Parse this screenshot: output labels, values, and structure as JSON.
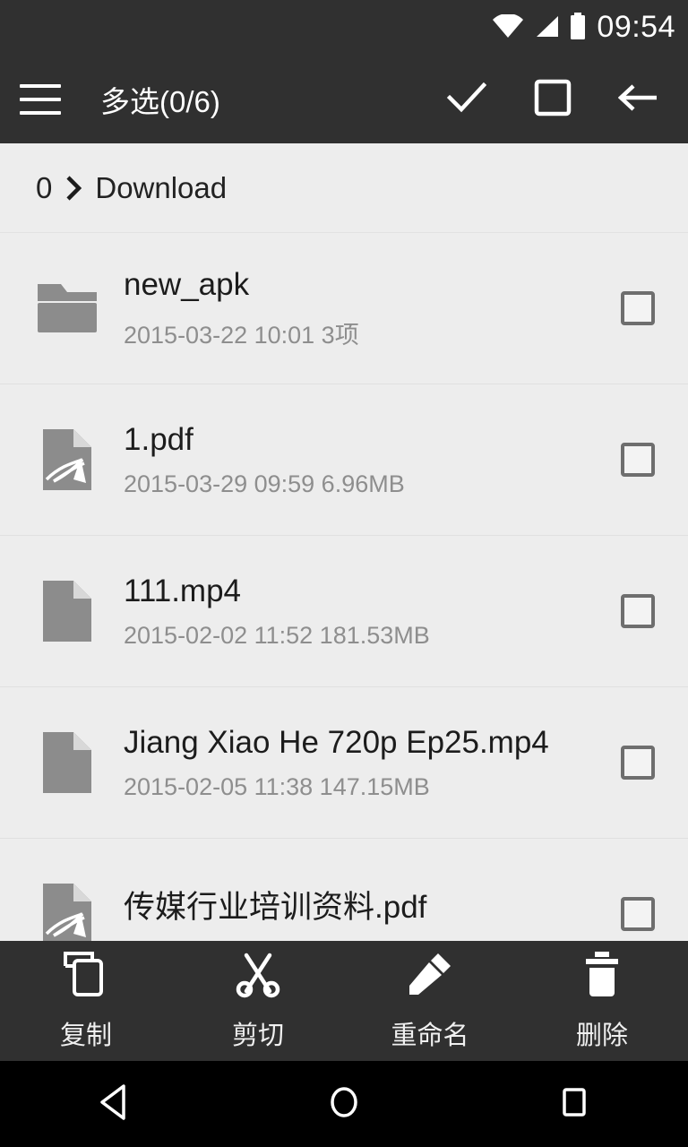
{
  "statusbar": {
    "time": "09:54",
    "icons": [
      "wifi-icon",
      "signal-icon",
      "battery-icon"
    ]
  },
  "appbar": {
    "menu_icon": "hamburger-menu-icon",
    "title": "多选(0/6)",
    "actions": [
      {
        "name": "select-all",
        "icon": "check-icon"
      },
      {
        "name": "invert-selection",
        "icon": "square-outline-icon"
      },
      {
        "name": "back",
        "icon": "arrow-left-icon"
      }
    ]
  },
  "breadcrumb": {
    "root": "0",
    "separator_icon": "chevron-right-icon",
    "current": "Download"
  },
  "files": [
    {
      "name": "new_apk",
      "meta": "2015-03-22 10:01  3项",
      "icon": "folder-icon",
      "checked": false
    },
    {
      "name": "1.pdf",
      "meta": "2015-03-29 09:59  6.96MB",
      "icon": "pdf-file-icon",
      "checked": false
    },
    {
      "name": "111.mp4",
      "meta": "2015-02-02 11:52  181.53MB",
      "icon": "generic-file-icon",
      "checked": false
    },
    {
      "name": "Jiang Xiao He 720p Ep25.mp4",
      "meta": "2015-02-05 11:38  147.15MB",
      "icon": "generic-file-icon",
      "checked": false
    },
    {
      "name": "传媒行业培训资料.pdf",
      "meta": "",
      "icon": "pdf-file-icon",
      "checked": false
    }
  ],
  "actionbar": [
    {
      "label": "复制",
      "icon": "copy-icon"
    },
    {
      "label": "剪切",
      "icon": "scissors-icon"
    },
    {
      "label": "重命名",
      "icon": "pencil-icon"
    },
    {
      "label": "删除",
      "icon": "trash-icon"
    }
  ],
  "navbar": [
    {
      "name": "back",
      "icon": "triangle-back-icon"
    },
    {
      "name": "home",
      "icon": "circle-home-icon"
    },
    {
      "name": "recents",
      "icon": "square-recents-icon"
    }
  ],
  "colors": {
    "appbar_bg": "#303030",
    "list_bg": "#ededed",
    "navbar_bg": "#000000",
    "icon_gray": "#8c8c8c",
    "meta_text": "#8e8e8e"
  }
}
